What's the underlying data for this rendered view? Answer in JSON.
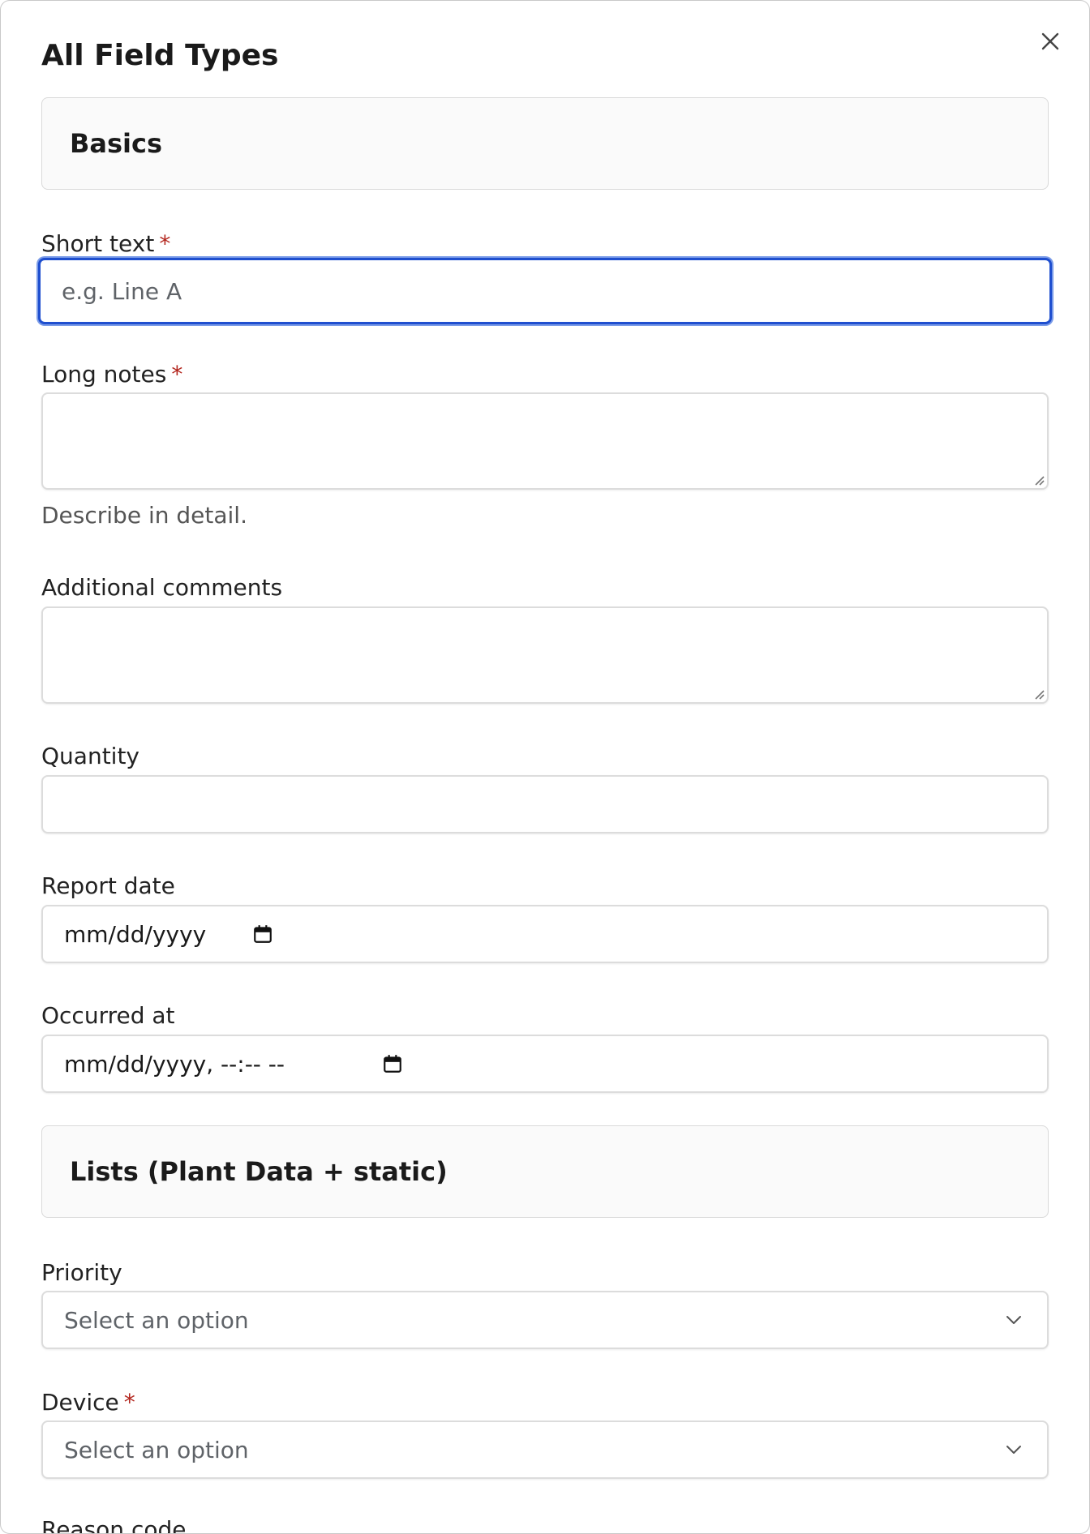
{
  "dialog": {
    "title": "All Field Types",
    "close_icon": "close-icon"
  },
  "sections": {
    "basics": "Basics",
    "lists": "Lists (Plant Data + static)"
  },
  "fields": {
    "short_text": {
      "label": "Short text",
      "required_mark": "*",
      "placeholder": "e.g. Line A",
      "value": ""
    },
    "long_notes": {
      "label": "Long notes",
      "required_mark": "*",
      "value": "",
      "helper": "Describe in detail."
    },
    "additional_comments": {
      "label": "Additional comments",
      "value": ""
    },
    "quantity": {
      "label": "Quantity",
      "value": ""
    },
    "report_date": {
      "label": "Report date",
      "display": "mm/dd/yyyy",
      "icon": "calendar-icon"
    },
    "occurred_at": {
      "label": "Occurred at",
      "display": "mm/dd/yyyy, --:-- --",
      "icon": "calendar-icon"
    },
    "priority": {
      "label": "Priority",
      "selected": "Select an option",
      "icon": "chevron-down-icon"
    },
    "device": {
      "label": "Device",
      "required_mark": "*",
      "selected": "Select an option",
      "icon": "chevron-down-icon"
    },
    "reason_code": {
      "label": "Reason code"
    }
  },
  "colors": {
    "focus_border": "#1f4fcf",
    "required": "#b3261e",
    "section_bg": "#fafafa"
  }
}
